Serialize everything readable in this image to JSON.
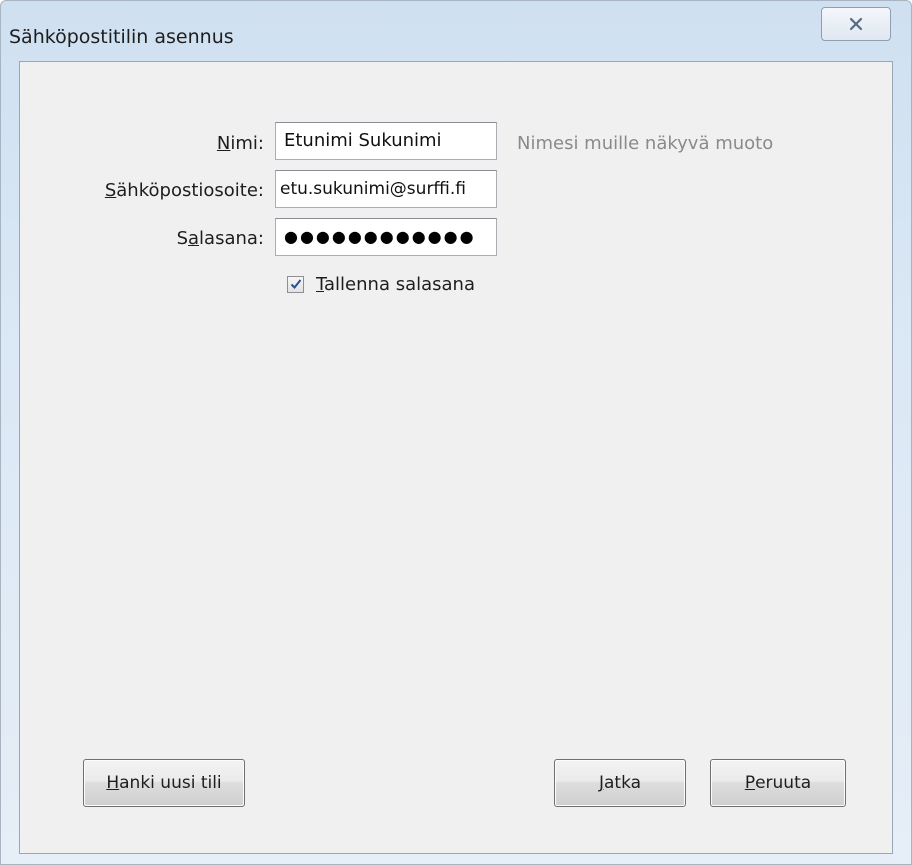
{
  "window": {
    "title": "Sähköpostitilin asennus"
  },
  "form": {
    "name_label_first": "N",
    "name_label_rest": "imi:",
    "name_value": "Etunimi Sukunimi",
    "name_hint": "Nimesi muille näkyvä muoto",
    "email_label_first": "S",
    "email_label_rest": "ähköpostiosoite:",
    "email_value": "etu.sukunimi@surffi.fi",
    "password_label_pre": "S",
    "password_label_u": "a",
    "password_label_rest": "lasana:",
    "password_value": "●●●●●●●●●●●●",
    "remember_checked": true,
    "remember_label_first": "T",
    "remember_label_rest": "allenna salasana"
  },
  "buttons": {
    "new_account_first": "H",
    "new_account_rest": "anki uusi tili",
    "continue_first": "J",
    "continue_rest": "atka",
    "cancel_first": "P",
    "cancel_rest": "eruuta"
  },
  "icons": {
    "close": "close-icon",
    "checkmark": "checkmark-icon"
  }
}
